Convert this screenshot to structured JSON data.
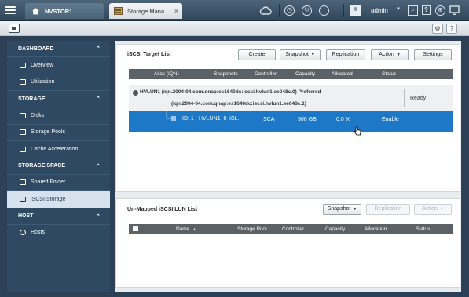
{
  "topbar": {
    "host_tab": "NVSTOR1",
    "app_tab": "Storage Mana...",
    "tab_close": "×",
    "user": "admin",
    "help": "?"
  },
  "subbar": {
    "help": "?"
  },
  "sidebar": {
    "sections": [
      {
        "label": "DASHBOARD",
        "items": [
          {
            "label": "Overview",
            "icon": "overview-icon"
          },
          {
            "label": "Utilization",
            "icon": "utilization-icon"
          }
        ]
      },
      {
        "label": "STORAGE",
        "items": [
          {
            "label": "Disks",
            "icon": "disk-icon"
          },
          {
            "label": "Storage Pools",
            "icon": "storage-pool-icon"
          },
          {
            "label": "Cache Acceleration",
            "icon": "cache-icon"
          }
        ]
      },
      {
        "label": "STORAGE SPACE",
        "items": [
          {
            "label": "Shared Folder",
            "icon": "folder-icon"
          },
          {
            "label": "iSCSI Storage",
            "icon": "iscsi-icon",
            "active": true
          }
        ]
      },
      {
        "label": "HOST",
        "items": [
          {
            "label": "Hosts",
            "icon": "gear-icon"
          }
        ]
      }
    ]
  },
  "target_panel": {
    "title": "iSCSI Target List",
    "buttons": {
      "create": "Create",
      "snapshot": "Snapshot",
      "replication": "Replication",
      "action": "Action",
      "settings": "Settings"
    },
    "columns": [
      "Alias (IQN)",
      "Snapshots",
      "Controller",
      "Capacity",
      "Allocated",
      "Status"
    ],
    "target": {
      "name": "HVLUN1 (iqn.2004-04.com.qnap:es1640dc:iscsi.hvlun1.ee048c.0) Preferred",
      "iqn2": "(iqn.2004-04.com.qnap:es1640dc:iscsi.hvlun1.ee048c.1)",
      "status": "Ready"
    },
    "lun": {
      "id": "ID: 1 - HVLUN1_0_iSt...",
      "controller": "SCA",
      "capacity": "500 GB",
      "allocated": "0.0 %",
      "status": "Enable"
    }
  },
  "unmapped_panel": {
    "title": "Un-Mapped iSCSI LUN List",
    "buttons": {
      "snapshot": "Snapshot",
      "replication": "Replication",
      "action": "Action"
    },
    "columns": [
      "Name",
      "Storage Pool",
      "Controller",
      "Capacity",
      "Allocation",
      "Status"
    ],
    "sort_arrow": "▲"
  }
}
